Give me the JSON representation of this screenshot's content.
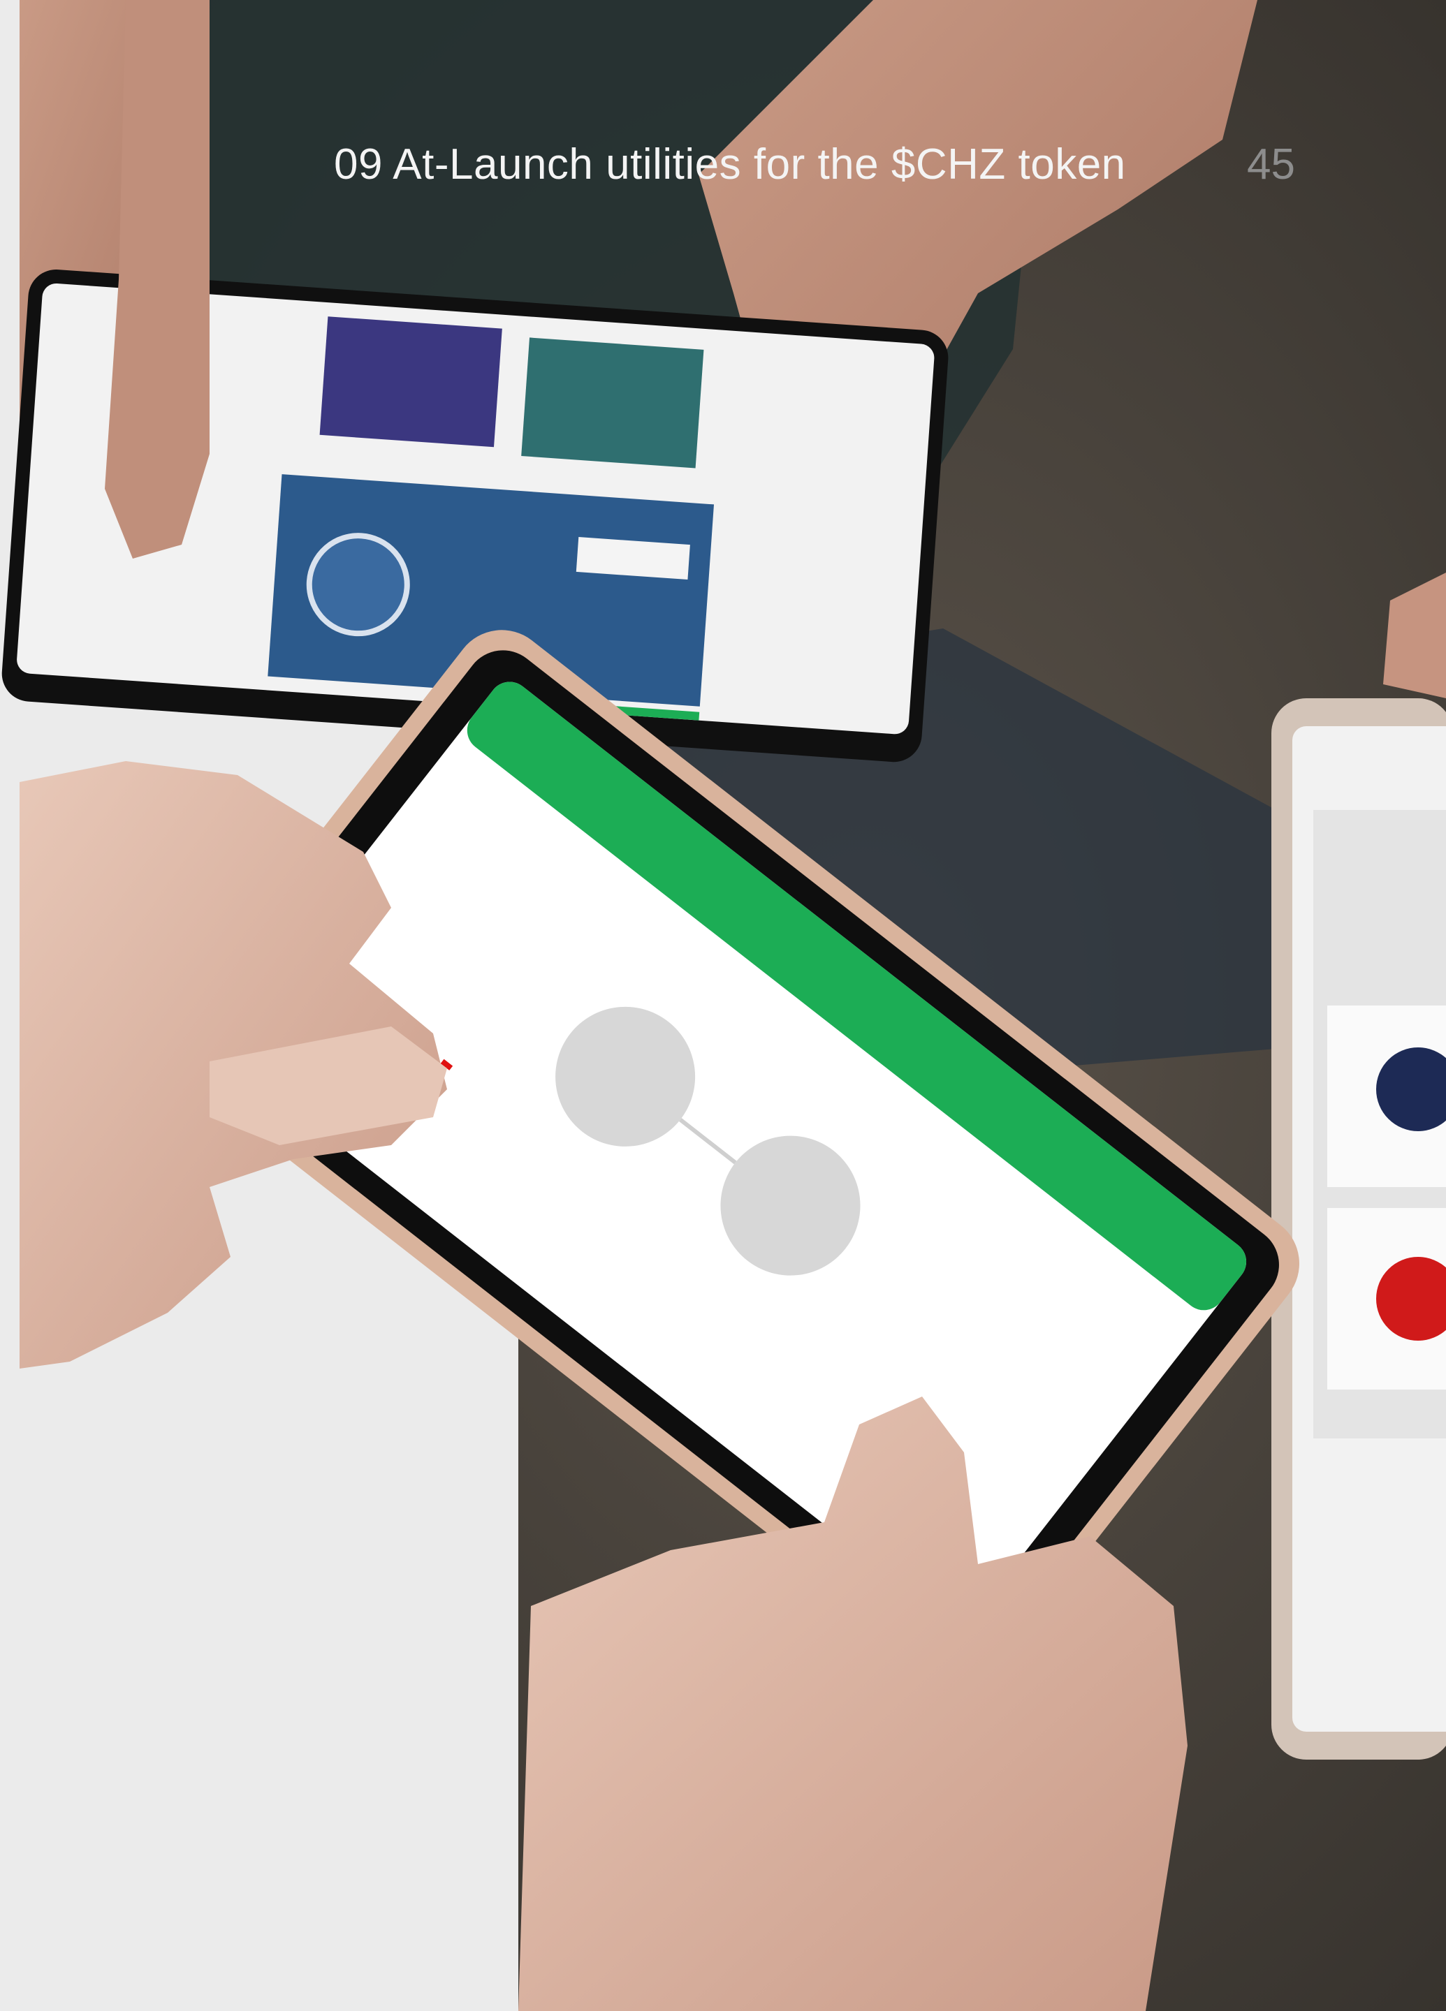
{
  "header": {
    "section_title": "09 At-Launch utilities for the $CHZ token",
    "page_number": "45"
  },
  "photo": {
    "description_icon": "photo-hands-smartphones",
    "colors": {
      "app_green": "#1cad55",
      "club_blue": "#2c5a8c",
      "background_gray": "#ebebeb"
    }
  }
}
